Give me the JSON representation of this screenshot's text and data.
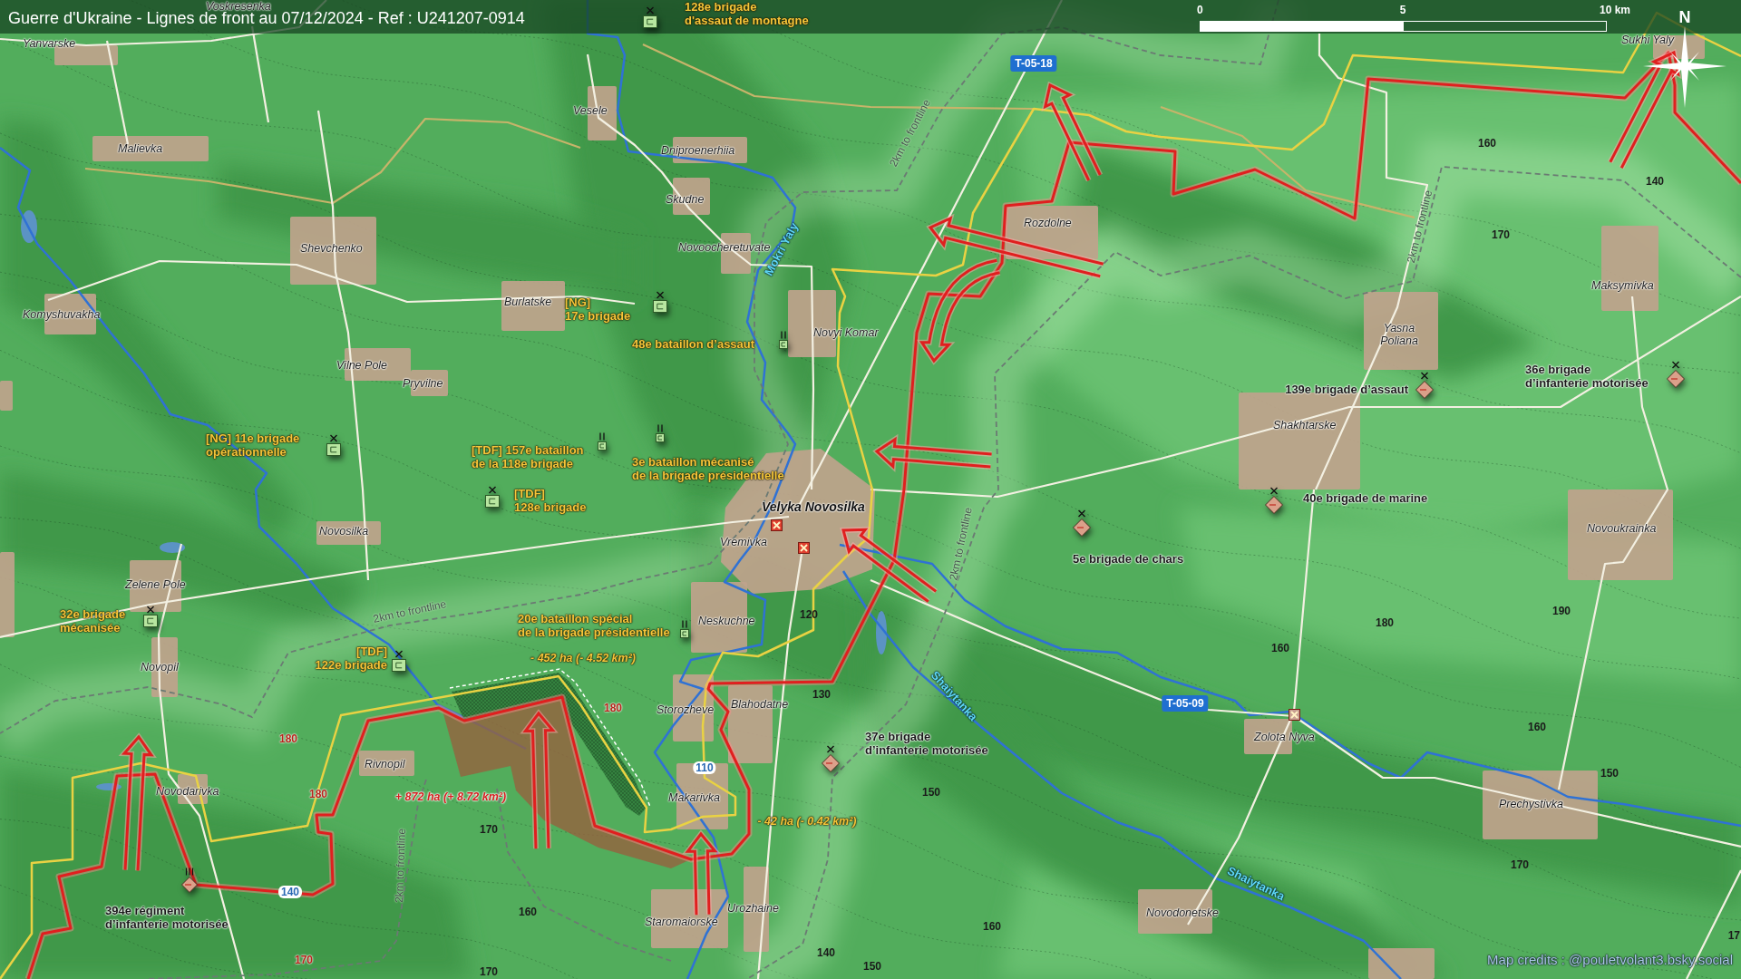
{
  "title_bar": {
    "title": "Guerre d'Ukraine - Lignes de front au 07/12/2024 - Ref : U241207-0914",
    "scale_labels": [
      "0",
      "5",
      "10 km"
    ]
  },
  "compass": {
    "label": "N"
  },
  "settlements": [
    {
      "name": "Voskresenka",
      "kind": "village"
    },
    {
      "name": "Yanvarske",
      "kind": "village"
    },
    {
      "name": "Vesele",
      "kind": "village"
    },
    {
      "name": "Malievka",
      "kind": "village"
    },
    {
      "name": "Dniproenerhiia",
      "kind": "village"
    },
    {
      "name": "Skudne",
      "kind": "village"
    },
    {
      "name": "Rozdolne",
      "kind": "village"
    },
    {
      "name": "Shevchenko",
      "kind": "village"
    },
    {
      "name": "Novoocheretuvate",
      "kind": "village"
    },
    {
      "name": "Komyshuvakha",
      "kind": "village"
    },
    {
      "name": "Burlatske",
      "kind": "village"
    },
    {
      "name": "Novyi Komar",
      "kind": "village"
    },
    {
      "name": "Vilne Pole",
      "kind": "village"
    },
    {
      "name": "Pryvilne",
      "kind": "village"
    },
    {
      "name": "Sukhi Yaly",
      "kind": "village"
    },
    {
      "name": "Maksymivka",
      "kind": "village"
    },
    {
      "name": "Yasna Poliana",
      "kind": "village"
    },
    {
      "name": "Shakhtarske",
      "kind": "village"
    },
    {
      "name": "Velyka Novosilka",
      "kind": "city"
    },
    {
      "name": "Vremivka",
      "kind": "village"
    },
    {
      "name": "Novosilka",
      "kind": "village"
    },
    {
      "name": "Novoukrainka",
      "kind": "village"
    },
    {
      "name": "Zelene Pole",
      "kind": "village"
    },
    {
      "name": "Neskuchne",
      "kind": "village"
    },
    {
      "name": "Novopil",
      "kind": "village"
    },
    {
      "name": "Storozheve",
      "kind": "village"
    },
    {
      "name": "Blahodatne",
      "kind": "village"
    },
    {
      "name": "Zolota Nyva",
      "kind": "village"
    },
    {
      "name": "Rivnopil",
      "kind": "village"
    },
    {
      "name": "Novodarivka",
      "kind": "village"
    },
    {
      "name": "Makarivka",
      "kind": "village"
    },
    {
      "name": "Prechystivka",
      "kind": "village"
    },
    {
      "name": "Urozhaine",
      "kind": "village"
    },
    {
      "name": "Novodonetske",
      "kind": "village"
    },
    {
      "name": "Staromaiorske",
      "kind": "village"
    }
  ],
  "ukrainian_units": [
    {
      "label_lines": [
        "128e brigade",
        "d'assaut de montagne"
      ],
      "kind": "brigade"
    },
    {
      "label_lines": [
        "[NG]",
        "17e brigade"
      ],
      "kind": "brigade"
    },
    {
      "label_lines": [
        "48e bataillon d’assaut"
      ],
      "kind": "battalion"
    },
    {
      "label_lines": [
        "[NG] 11e brigade",
        "opérationnelle"
      ],
      "kind": "brigade"
    },
    {
      "label_lines": [
        "[TDF] 157e bataillon",
        "de la 118e brigade"
      ],
      "kind": "battalion"
    },
    {
      "label_lines": [
        "3e bataillon mécanisé",
        "de la brigade présidentielle"
      ],
      "kind": "battalion"
    },
    {
      "label_lines": [
        "[TDF]",
        "128e brigade"
      ],
      "kind": "brigade"
    },
    {
      "label_lines": [
        "32e brigade",
        "mécanisée"
      ],
      "kind": "brigade"
    },
    {
      "label_lines": [
        "20e bataillon spécial",
        "de la brigade présidentielle"
      ],
      "kind": "battalion"
    },
    {
      "label_lines": [
        "[TDF]",
        "122e brigade"
      ],
      "kind": "brigade"
    }
  ],
  "russian_units": [
    {
      "label_lines": [
        "139e brigade d’assaut"
      ],
      "kind": "brigade"
    },
    {
      "label_lines": [
        "36e brigade",
        "d’infanterie motorisée"
      ],
      "kind": "brigade"
    },
    {
      "label_lines": [
        "40e brigade de marine"
      ],
      "kind": "brigade"
    },
    {
      "label_lines": [
        "5e brigade de chars"
      ],
      "kind": "brigade"
    },
    {
      "label_lines": [
        "37e brigade",
        "d’infanterie motorisée"
      ],
      "kind": "brigade"
    },
    {
      "label_lines": [
        "394e régiment",
        "d’infanterie motorisée"
      ],
      "kind": "regiment"
    }
  ],
  "road_labels": [
    {
      "text": "T-05-18",
      "kind": "shield"
    },
    {
      "text": "T-05-09",
      "kind": "shield"
    },
    {
      "text": "110",
      "kind": "number"
    },
    {
      "text": "140",
      "kind": "number"
    }
  ],
  "frontline_distance_labels": [
    "2km to frontline",
    "2km to frontline",
    "2km to frontline",
    "2km to frontline",
    "2km to frontline"
  ],
  "river_labels": [
    {
      "name": "Mokri Yaly"
    },
    {
      "name": "Shaiytanka"
    },
    {
      "name": "Shaiytanka"
    }
  ],
  "elevations": [
    {
      "text": "160",
      "color": "#1a1a1a"
    },
    {
      "text": "140",
      "color": "#1a1a1a"
    },
    {
      "text": "170",
      "color": "#1a1a1a"
    },
    {
      "text": "120",
      "color": "#1a1a1a"
    },
    {
      "text": "180",
      "color": "#1a1a1a"
    },
    {
      "text": "190",
      "color": "#1a1a1a"
    },
    {
      "text": "160",
      "color": "#1a1a1a"
    },
    {
      "text": "130",
      "color": "#1a1a1a"
    },
    {
      "text": "180",
      "color": "#b8231b"
    },
    {
      "text": "160",
      "color": "#1a1a1a"
    },
    {
      "text": "180",
      "color": "#b8231b"
    },
    {
      "text": "150",
      "color": "#1a1a1a"
    },
    {
      "text": "150",
      "color": "#1a1a1a"
    },
    {
      "text": "180",
      "color": "#b8231b"
    },
    {
      "text": "170",
      "color": "#1a1a1a"
    },
    {
      "text": "170",
      "color": "#1a1a1a"
    },
    {
      "text": "160",
      "color": "#1a1a1a"
    },
    {
      "text": "160",
      "color": "#1a1a1a"
    },
    {
      "text": "17",
      "color": "#1a1a1a"
    },
    {
      "text": "140",
      "color": "#1a1a1a"
    },
    {
      "text": "170",
      "color": "#b8231b"
    },
    {
      "text": "150",
      "color": "#1a1a1a"
    },
    {
      "text": "170",
      "color": "#1a1a1a"
    }
  ],
  "area_changes": [
    {
      "text": "- 452 ha (- 4.52 km²)",
      "kind": "loss"
    },
    {
      "text": "+ 872 ha (+ 8.72 km²)",
      "kind": "gain"
    },
    {
      "text": "- 42 ha (- 0.42 km²)",
      "kind": "loss"
    }
  ],
  "markers": [
    {
      "color": "#e0402f"
    },
    {
      "color": "#e0402f"
    },
    {
      "color": "#c8a092"
    }
  ],
  "credits": "Map credits : @pouletvolant3.bsky.social"
}
